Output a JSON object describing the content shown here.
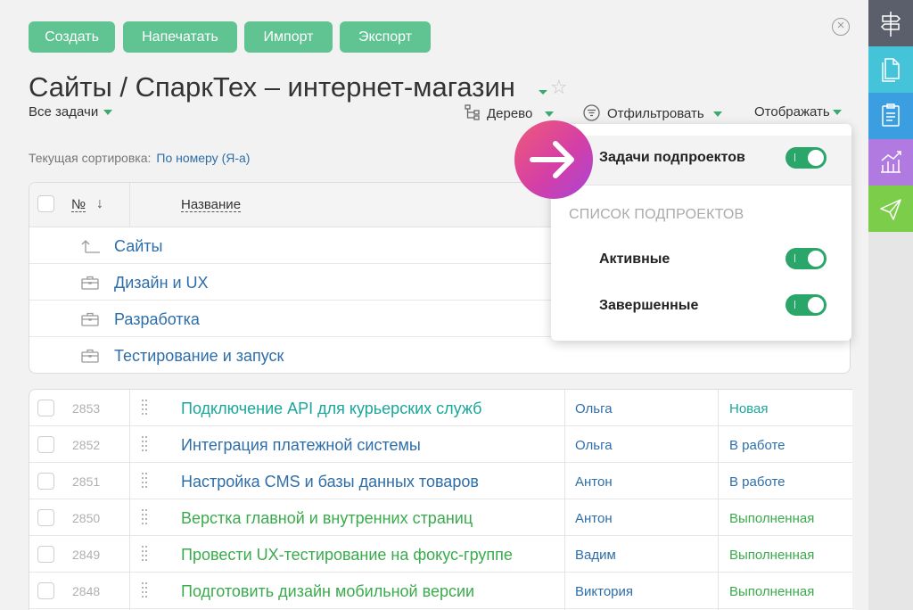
{
  "toolbar": {
    "create": "Создать",
    "print": "Напечатать",
    "import": "Импорт",
    "export": "Экспорт"
  },
  "header": {
    "title": "Сайты / СпаркТех – интернет-магазин",
    "all_tasks": "Все задачи",
    "tree": "Дерево",
    "filter": "Отфильтровать",
    "display": "Отображать"
  },
  "sorting": {
    "label": "Текущая сортировка:",
    "value": "По номеру (Я-а)"
  },
  "table": {
    "col_number": "№",
    "col_name": "Название",
    "projects": [
      {
        "label": "Сайты",
        "icon": "up-arrow-icon"
      },
      {
        "label": "Дизайн и UX",
        "icon": "briefcase-icon"
      },
      {
        "label": "Разработка",
        "icon": "briefcase-icon"
      },
      {
        "label": "Тестирование и запуск",
        "icon": "briefcase-icon"
      }
    ],
    "tasks": [
      {
        "id": "2853",
        "name": "Подключение API для курьерских служб",
        "user": "Ольга",
        "status": "Новая",
        "name_color": "#1aa69a",
        "status_color": "#1aa69a"
      },
      {
        "id": "2852",
        "name": "Интеграция платежной системы",
        "user": "Ольга",
        "status": "В работе",
        "name_color": "#2e6ea8",
        "status_color": "#2e6ea8"
      },
      {
        "id": "2851",
        "name": "Настройка CMS и базы данных товаров",
        "user": "Антон",
        "status": "В работе",
        "name_color": "#2e6ea8",
        "status_color": "#2e6ea8"
      },
      {
        "id": "2850",
        "name": "Верстка главной и внутренних страниц",
        "user": "Антон",
        "status": "Выполненная",
        "name_color": "#3aab4c",
        "status_color": "#3aab4c"
      },
      {
        "id": "2849",
        "name": "Провести UX-тестирование на фокус-группе",
        "user": "Вадим",
        "status": "Выполненная",
        "name_color": "#3aab4c",
        "status_color": "#3aab4c"
      },
      {
        "id": "2848",
        "name": "Подготовить дизайн мобильной версии",
        "user": "Виктория",
        "status": "Выполненная",
        "name_color": "#3aab4c",
        "status_color": "#3aab4c"
      }
    ]
  },
  "popup": {
    "subproject_tasks": "Задачи подпроектов",
    "section_title": "СПИСОК ПОДПРОЕКТОВ",
    "active": "Активные",
    "completed": "Завершенные",
    "subproject_tasks_on": true,
    "active_on": true,
    "completed_on": true
  },
  "sidebar": {
    "items": [
      {
        "icon": "signpost-icon",
        "color": "#5a5f6b"
      },
      {
        "icon": "documents-icon",
        "color": "#45c3d8"
      },
      {
        "icon": "clipboard-icon",
        "color": "#3a9ee0"
      },
      {
        "icon": "chart-icon",
        "color": "#b07ae0"
      },
      {
        "icon": "send-icon",
        "color": "#7ccd4a"
      }
    ]
  },
  "colors": {
    "accent_green": "#5fc392",
    "link_blue": "#2e6ea8",
    "toggle_green": "#2aa66a"
  }
}
